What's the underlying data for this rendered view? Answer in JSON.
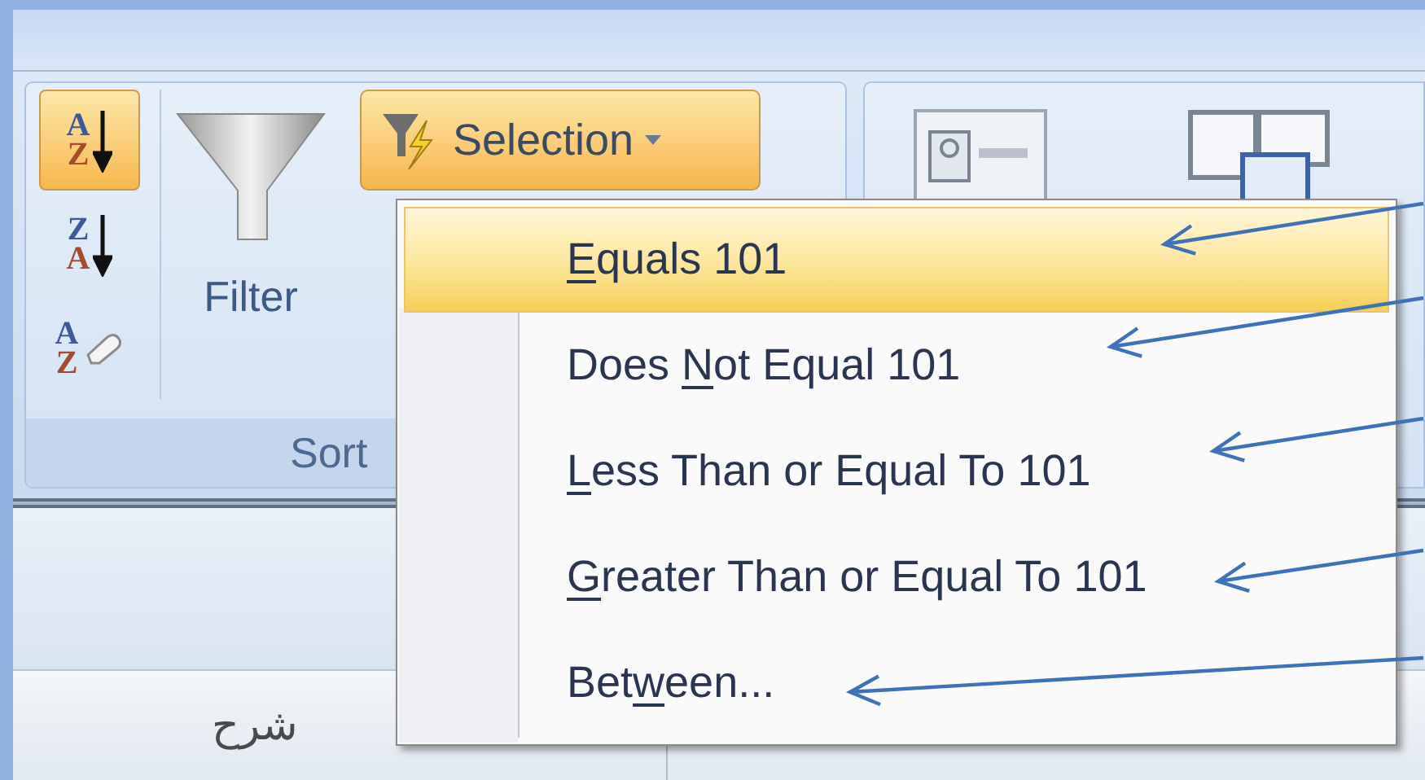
{
  "ribbon": {
    "sort_buttons": [
      {
        "kind": "ascending",
        "top": "A",
        "bottom": "Z",
        "selected": true
      },
      {
        "kind": "descending",
        "top": "Z",
        "bottom": "A",
        "selected": false
      },
      {
        "kind": "clear",
        "top": "A",
        "bottom": "Z",
        "selected": false
      }
    ],
    "filter_button": {
      "label": "Filter"
    },
    "selection_button": {
      "label": "Selection",
      "open": true
    },
    "group_label": "Sort"
  },
  "selection_menu": {
    "items": [
      {
        "key": "E",
        "after": "quals 101",
        "selected": true,
        "annotated": true
      },
      {
        "before": "Does ",
        "key": "N",
        "after": "ot Equal 101",
        "selected": false,
        "annotated": true
      },
      {
        "key": "L",
        "after": "ess Than or Equal To 101",
        "selected": false,
        "annotated": true
      },
      {
        "key": "G",
        "after": "reater Than or Equal To 101",
        "selected": false,
        "annotated": true
      },
      {
        "before": "Bet",
        "key": "w",
        "after": "een...",
        "selected": false,
        "annotated": true
      }
    ]
  },
  "table": {
    "columns": [
      "شرح"
    ]
  }
}
